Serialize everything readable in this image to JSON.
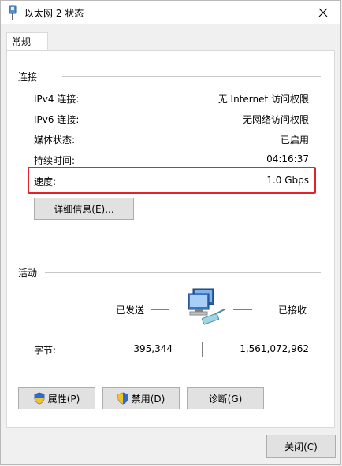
{
  "window": {
    "title": "以太网 2 状态"
  },
  "tabs": [
    {
      "label": "常规"
    }
  ],
  "connection": {
    "section_title": "连接",
    "rows": [
      {
        "label": "IPv4 连接:",
        "value": "无 Internet 访问权限"
      },
      {
        "label": "IPv6 连接:",
        "value": "无网络访问权限"
      },
      {
        "label": "媒体状态:",
        "value": "已启用"
      },
      {
        "label": "持续时间:",
        "value": "04:16:37"
      },
      {
        "label": "速度:",
        "value": "1.0 Gbps"
      }
    ],
    "details_button": "详细信息(E)...",
    "highlight_color": "#e0242b"
  },
  "activity": {
    "section_title": "活动",
    "sent_label": "已发送",
    "received_label": "已接收",
    "bytes_label": "字节:",
    "bytes_sent": "395,344",
    "bytes_received": "1,561,072,962"
  },
  "buttons": {
    "properties": "属性(P)",
    "disable": "禁用(D)",
    "diagnose": "诊断(G)",
    "close": "关闭(C)"
  },
  "icons": {
    "title": "ethernet-adapter-icon",
    "shield": "uac-shield-icon",
    "network": "network-computers-icon",
    "close": "close-icon"
  }
}
